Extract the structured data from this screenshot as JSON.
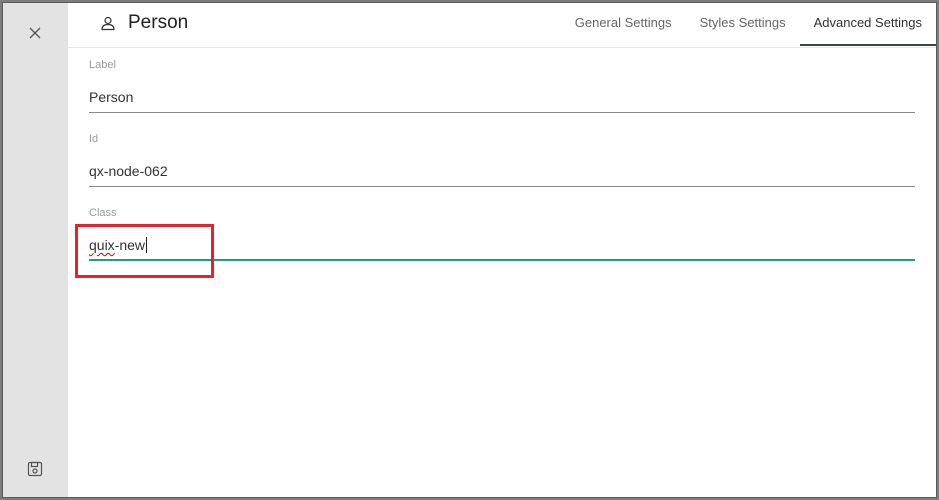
{
  "header": {
    "title": "Person",
    "tabs": [
      {
        "label": "General Settings",
        "active": false
      },
      {
        "label": "Styles Settings",
        "active": false
      },
      {
        "label": "Advanced Settings",
        "active": true
      }
    ]
  },
  "fields": {
    "label": {
      "label": "Label",
      "value": "Person"
    },
    "id": {
      "label": "Id",
      "value": "qx-node-062"
    },
    "class": {
      "label": "Class",
      "value_misspelled": "quix",
      "value_rest": "-new",
      "value": "quix-new",
      "focused": true
    }
  },
  "colors": {
    "accent": "#1f9e86",
    "highlight": "#e6212a",
    "rail": "#e3e3e3"
  },
  "icons": {
    "close": "close-icon",
    "title": "person-icon",
    "save": "save-icon"
  }
}
